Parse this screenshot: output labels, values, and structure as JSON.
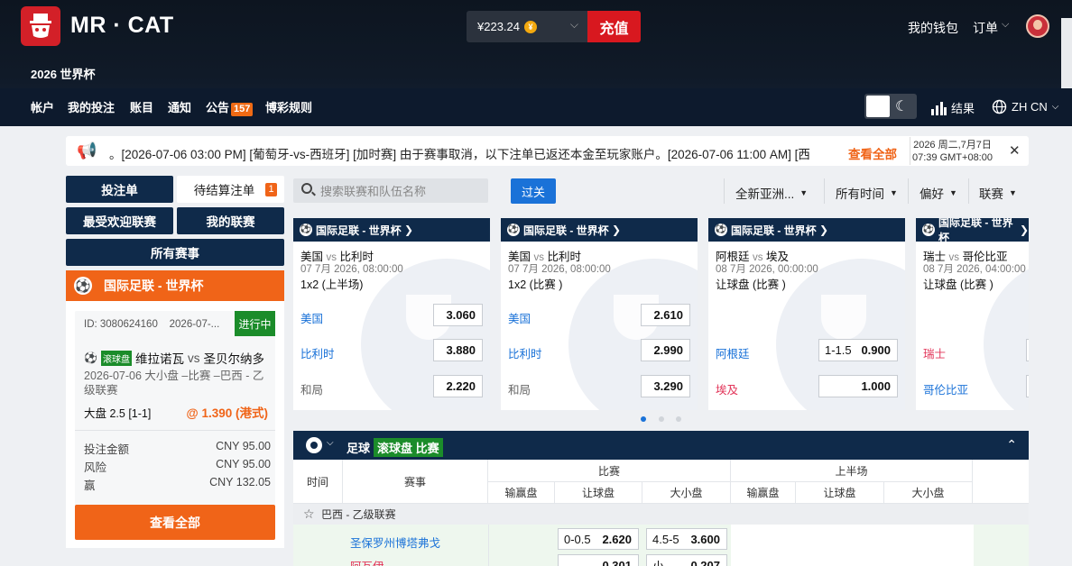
{
  "header": {
    "brand": "MR · CAT",
    "tournament": "2026 世界杯",
    "balance": "¥223.24",
    "coin_glyph": "¥",
    "deposit": "充值",
    "wallet": "我的钱包",
    "orders": "订单"
  },
  "nav": {
    "items": [
      "帐户",
      "我的投注",
      "账目",
      "通知",
      "公告",
      "博彩规则"
    ],
    "announce_badge": "157",
    "results": "结果",
    "lang": "ZH CN"
  },
  "ticker": {
    "message": "。[2026-07-06 03:00 PM] [葡萄牙-vs-西班牙] [加时赛]    由于赛事取消，以下注单已返还本金至玩家账户。[2026-07-06 11:00 AM] [西",
    "view_all": "查看全部",
    "date_line1": "2026 周二,7月7日",
    "date_line2": "07:39 GMT+08:00"
  },
  "left": {
    "bet_slip": "投注单",
    "pending": "待结算注单",
    "pending_count": "1",
    "popular": "最受欢迎联赛",
    "my_leagues": "我的联赛",
    "all_matches": "所有赛事",
    "league": "国际足联 - 世界杯",
    "bet": {
      "id": "ID: 3080624160",
      "date": "2026-07-...",
      "status": "进行中",
      "tag": "滚球盘",
      "home": "维拉诺瓦",
      "vs": "vs",
      "away": "圣贝尔纳多",
      "desc": "2026-07-06 大小盘 –比赛 –巴西 - 乙级联赛",
      "selection": "大盘  2.5 [1-1]",
      "odds": "@ 1.390 (港式)",
      "rows": [
        {
          "label": "投注金额",
          "value": "CNY 95.00"
        },
        {
          "label": "风险",
          "value": "CNY 95.00"
        },
        {
          "label": "赢",
          "value": "CNY 132.05"
        }
      ],
      "view_all": "查看全部"
    }
  },
  "toolbar": {
    "search_placeholder": "搜索联赛和队伍名称",
    "parlay": "过关",
    "filters": [
      "全新亚洲...",
      "所有时间",
      "偏好",
      "联赛"
    ]
  },
  "cards": [
    {
      "league": "国际足联 - 世界杯",
      "home": "美国",
      "away": "比利时",
      "time": "07 7月 2026, 08:00:00",
      "market": "1x2 (上半场)",
      "rows": [
        {
          "name": "美国",
          "hc": "",
          "odds": "3.060",
          "style": "blue"
        },
        {
          "name": "比利时",
          "hc": "",
          "odds": "3.880",
          "style": "blue"
        },
        {
          "name": "和局",
          "hc": "",
          "odds": "2.220",
          "style": "gray"
        }
      ]
    },
    {
      "league": "国际足联 - 世界杯",
      "home": "美国",
      "away": "比利时",
      "time": "07 7月 2026, 08:00:00",
      "market": "1x2 (比赛 )",
      "rows": [
        {
          "name": "美国",
          "hc": "",
          "odds": "2.610",
          "style": "blue"
        },
        {
          "name": "比利时",
          "hc": "",
          "odds": "2.990",
          "style": "blue"
        },
        {
          "name": "和局",
          "hc": "",
          "odds": "3.290",
          "style": "gray"
        }
      ]
    },
    {
      "league": "国际足联 - 世界杯",
      "home": "阿根廷",
      "away": "埃及",
      "time": "08 7月 2026, 00:00:00",
      "market": "让球盘 (比赛 )",
      "rows": [
        {
          "name": "",
          "hc": "",
          "odds": "",
          "style": "blue"
        },
        {
          "name": "阿根廷",
          "hc": "1-1.5",
          "odds": "0.900",
          "style": "blue"
        },
        {
          "name": "埃及",
          "hc": "",
          "odds": "1.000",
          "style": "red"
        }
      ]
    },
    {
      "league": "国际足联 - 世界杯",
      "home": "瑞士",
      "away": "哥伦比亚",
      "time": "08 7月 2026, 04:00:00",
      "market": "让球盘 (比赛 )",
      "rows": [
        {
          "name": "",
          "hc": "",
          "odds": "",
          "style": "blue"
        },
        {
          "name": "瑞士",
          "hc": "",
          "odds": "",
          "style": "red"
        },
        {
          "name": "哥伦比亚",
          "hc": "",
          "odds": "",
          "style": "blue"
        }
      ]
    }
  ],
  "table": {
    "sport": "足球",
    "tag": "滚球盘 比赛",
    "col_time": "时间",
    "col_event": "赛事",
    "grp_match": "比赛",
    "grp_half": "上半场",
    "sub": [
      "输赢盘",
      "让球盘",
      "大小盘",
      "输赢盘",
      "让球盘",
      "大小盘"
    ],
    "league_row": "巴西 - 乙级联赛",
    "home": "圣保罗州博塔弗戈",
    "away": "阿瓦伊",
    "odds": [
      {
        "hc": "0-0.5",
        "odds": "2.620"
      },
      {
        "hc": "4.5-5",
        "odds": "3.600"
      },
      {
        "hc": "",
        "odds": "0.301"
      },
      {
        "hc": "小",
        "odds": "0.207"
      }
    ]
  }
}
